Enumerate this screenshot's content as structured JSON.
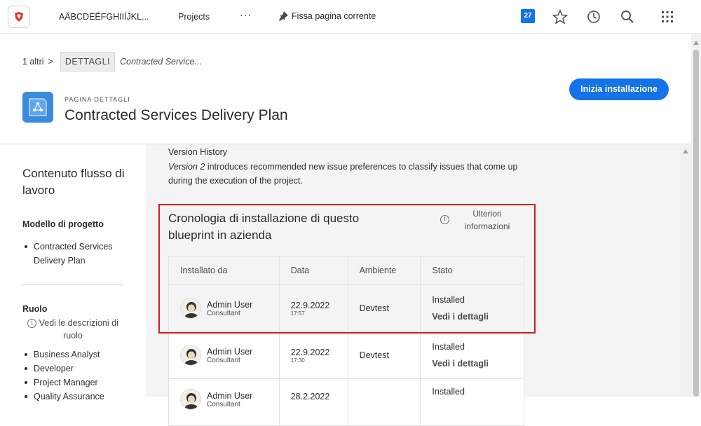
{
  "nav": {
    "org": "AÄBCDEÉFGHIIÍJKL...",
    "projects": "Projects",
    "more": "···",
    "pin": "Fissa pagina corrente",
    "badge": "27",
    "accent": "#1473e6"
  },
  "breadcrumb": {
    "first": "1 altri",
    "sep": ">",
    "active": "DETTAGLI",
    "current": "Contracted Service..."
  },
  "header": {
    "eyebrow": "PAGINA DETTAGLI",
    "title": "Contracted Services Delivery Plan",
    "install_button": "Inizia installazione"
  },
  "sidebar": {
    "title": "Contenuto flusso di lavoro",
    "template_heading": "Modello di progetto",
    "template_items": [
      "Contracted Services Delivery Plan"
    ],
    "role_heading": "Ruolo",
    "role_link": "Vedi le descrizioni di ruolo",
    "role_items": [
      "Business Analyst",
      "Developer",
      "Project Manager",
      "Quality Assurance"
    ]
  },
  "main": {
    "vh_title": "Version History",
    "vh_version": "Version 2",
    "vh_text": " introduces recommended new issue preferences to classify issues that come up during the execution of the project.",
    "card_title": "Cronologia di installazione di questo blueprint in azienda",
    "more_info": "Ulteriori informazioni",
    "columns": [
      "Installato da",
      "Data",
      "Ambiente",
      "Stato"
    ],
    "rows": [
      {
        "name": "Admin User",
        "role": "Consultant",
        "date": "22.9.2022",
        "time": "17:57",
        "env": "Devtest",
        "status": "Installed",
        "link": "Vedi i dettagli"
      },
      {
        "name": "Admin User",
        "role": "Consultant",
        "date": "22.9.2022",
        "time": "17:30",
        "env": "Devtest",
        "status": "Installed",
        "link": "Vedi i dettagli"
      },
      {
        "name": "Admin User",
        "role": "Consultant",
        "date": "28.2.2022",
        "time": "",
        "env": "",
        "status": "Installed",
        "link": ""
      }
    ]
  }
}
